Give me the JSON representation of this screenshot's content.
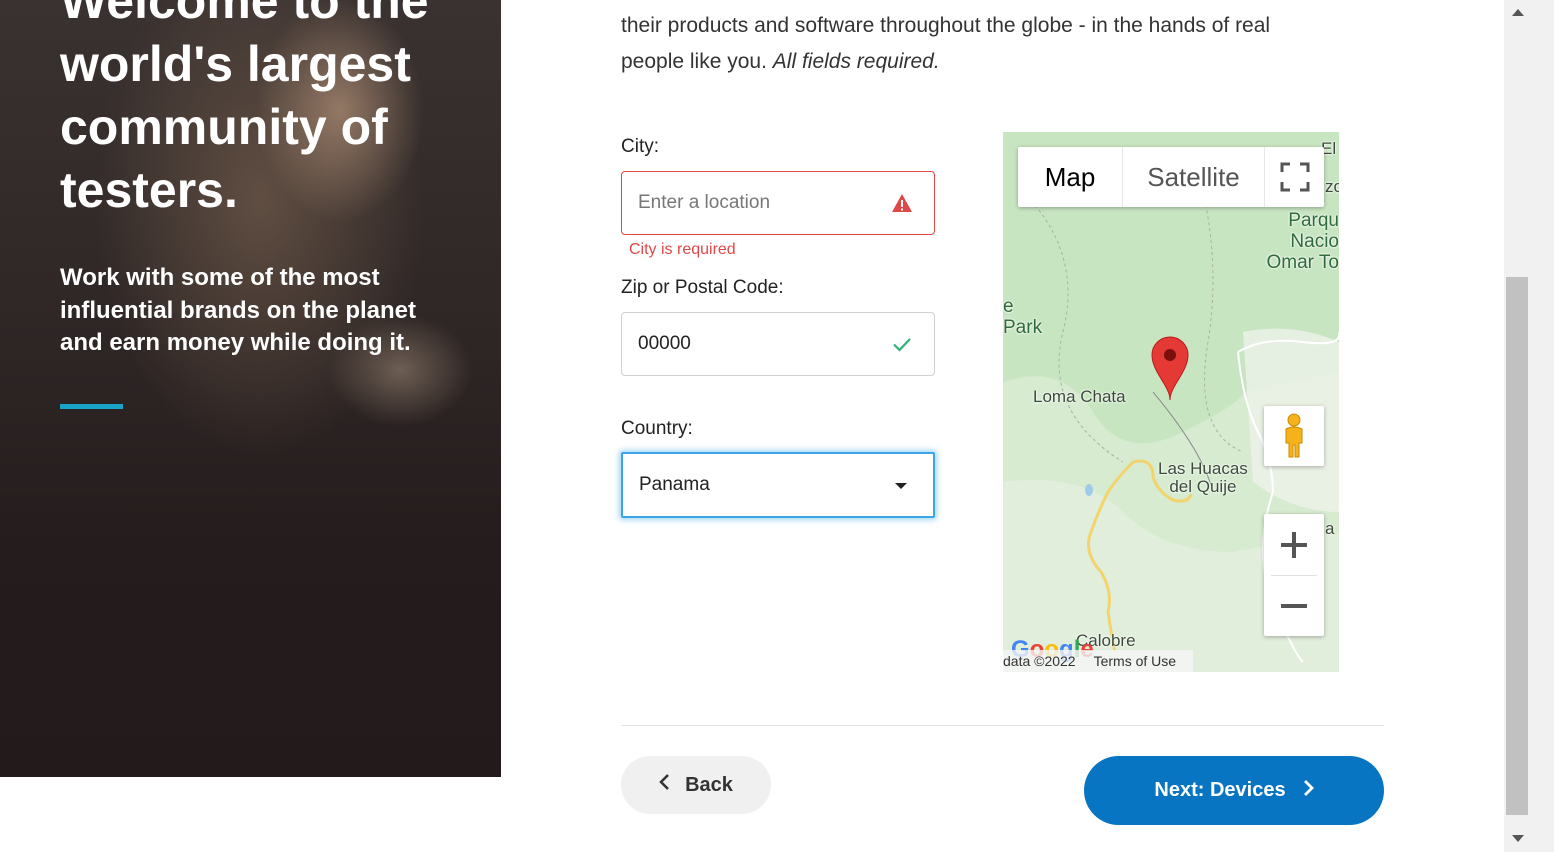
{
  "hero": {
    "heading": "Welcome to the world's largest community of testers.",
    "subtext": "Work with some of the most influential brands on the planet and earn money while doing it."
  },
  "intro": {
    "line1": "their products and software throughout the globe - in the hands of real",
    "line2": "people like you.",
    "required_note": "All fields required."
  },
  "form": {
    "city": {
      "label": "City:",
      "placeholder": "Enter a location",
      "error": "City is required",
      "status_icon": "warning-icon"
    },
    "zip": {
      "label": "Zip or Postal Code:",
      "value": "00000",
      "status_icon": "check-icon"
    },
    "country": {
      "label": "Country:",
      "selected": "Panama"
    }
  },
  "map": {
    "type_map": "Map",
    "type_satellite": "Satellite",
    "labels": {
      "top_partial": "El I",
      "top_partial2": "zo",
      "park": "Parqu\nNacio\nOmar To",
      "left_partial": "e\nPark",
      "loma": "Loma Chata",
      "huacas": "Las Huacas\ndel Quije",
      "calobre": "Calobre",
      "right_partial": "a"
    },
    "footer_data": "data ©2022",
    "footer_terms": "Terms of Use",
    "logo": "Google"
  },
  "nav": {
    "back_label": "Back",
    "next_label": "Next: Devices"
  },
  "colors": {
    "primary": "#0875c3",
    "error": "#e04848",
    "success": "#2bb673",
    "accent": "#1aa3c8"
  }
}
